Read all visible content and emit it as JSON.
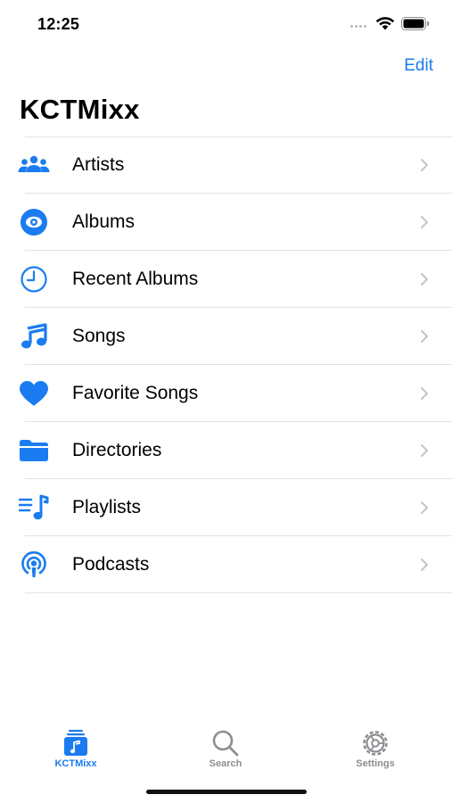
{
  "status_bar": {
    "time": "12:25"
  },
  "nav": {
    "edit_label": "Edit",
    "title": "KCTMixx"
  },
  "colors": {
    "accent": "#1a7cf0",
    "inactive": "#8e8e93",
    "separator": "#e2e2e6"
  },
  "list": {
    "items": [
      {
        "label": "Artists",
        "icon": "artists-icon"
      },
      {
        "label": "Albums",
        "icon": "album-disc-icon"
      },
      {
        "label": "Recent Albums",
        "icon": "clock-icon"
      },
      {
        "label": "Songs",
        "icon": "music-note-icon"
      },
      {
        "label": "Favorite Songs",
        "icon": "heart-icon"
      },
      {
        "label": "Directories",
        "icon": "folder-icon"
      },
      {
        "label": "Playlists",
        "icon": "playlist-icon"
      },
      {
        "label": "Podcasts",
        "icon": "podcast-icon"
      }
    ]
  },
  "tabbar": {
    "tabs": [
      {
        "label": "KCTMixx",
        "icon": "library-icon",
        "selected": true
      },
      {
        "label": "Search",
        "icon": "search-icon",
        "selected": false
      },
      {
        "label": "Settings",
        "icon": "gear-icon",
        "selected": false
      }
    ]
  }
}
